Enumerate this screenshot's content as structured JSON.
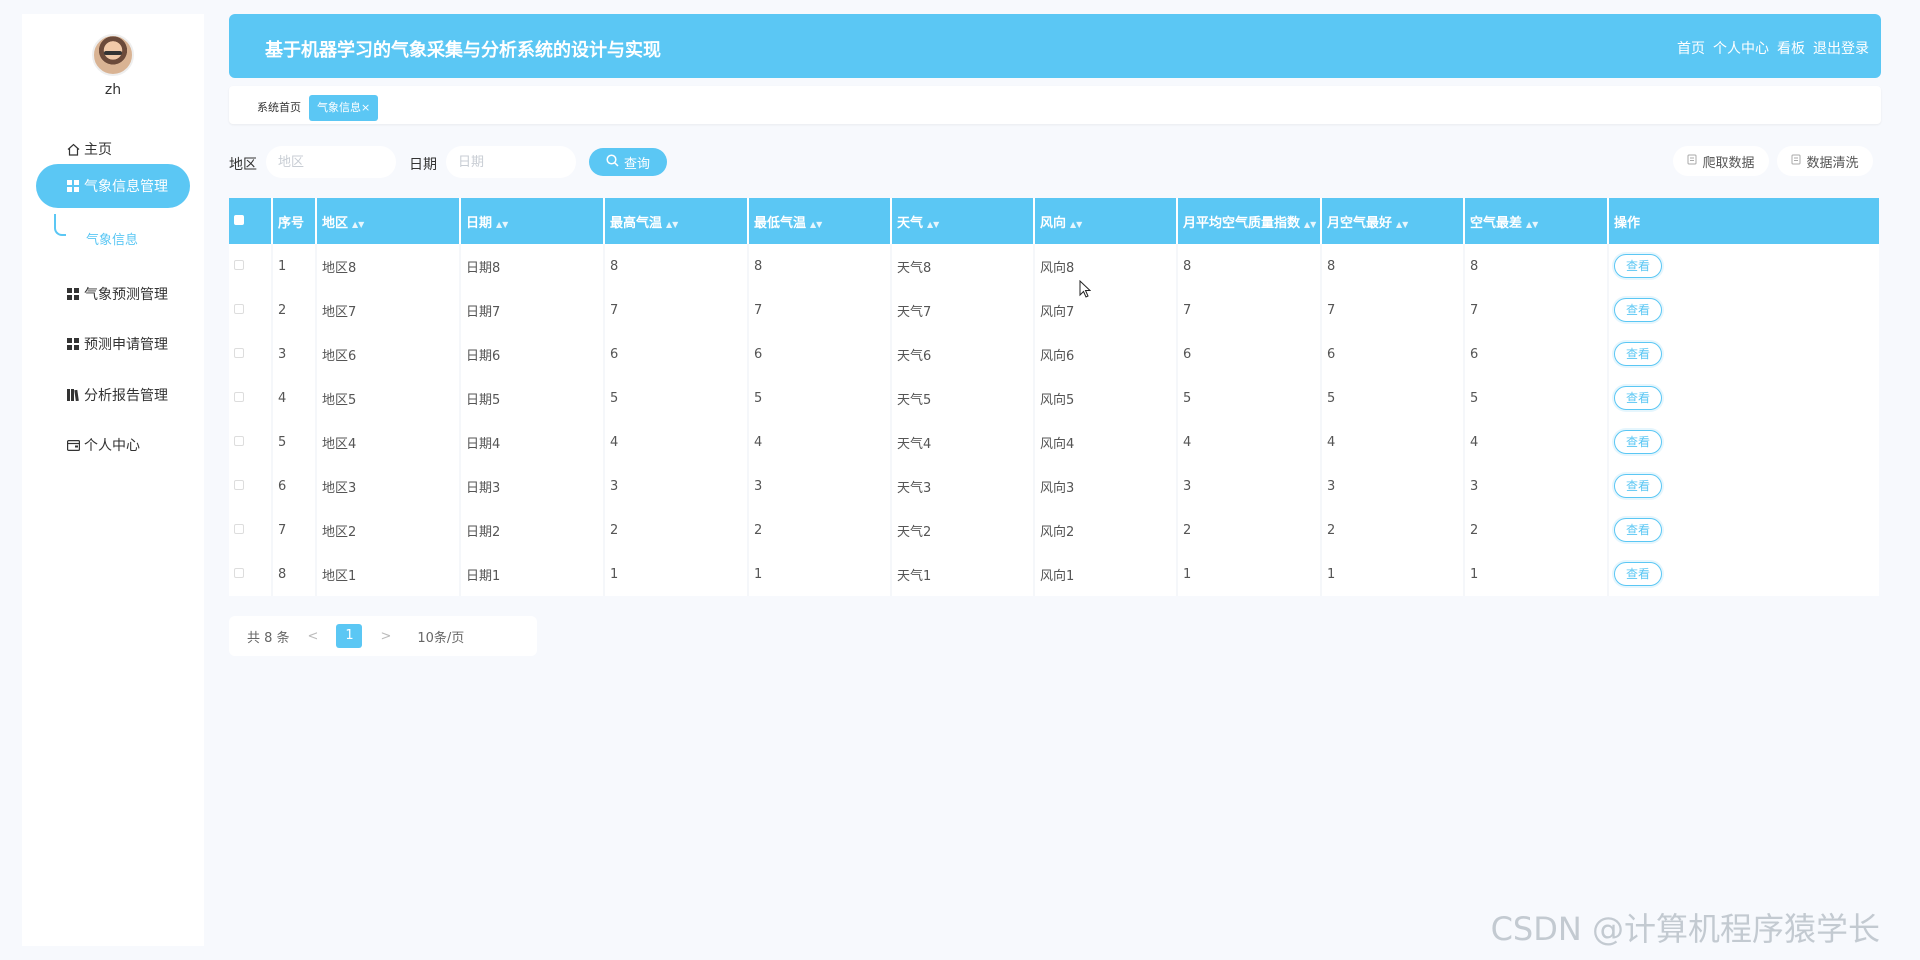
{
  "user": {
    "name": "zh"
  },
  "sidebar": {
    "items": [
      {
        "label": "主页",
        "icon": "home-icon"
      },
      {
        "label": "气象信息管理",
        "icon": "grid-icon",
        "active": true
      },
      {
        "label": "气象预测管理",
        "icon": "grid-icon"
      },
      {
        "label": "预测申请管理",
        "icon": "grid-icon"
      },
      {
        "label": "分析报告管理",
        "icon": "book-icon"
      },
      {
        "label": "个人中心",
        "icon": "wallet-icon"
      }
    ],
    "submenu": {
      "label": "气象信息"
    }
  },
  "header": {
    "title": "基于机器学习的气象采集与分析系统的设计与实现",
    "nav": [
      "首页",
      "个人中心",
      "看板",
      "退出登录"
    ]
  },
  "tabs": [
    {
      "label": "系统首页"
    },
    {
      "label": "气象信息",
      "close": "×",
      "active": true
    }
  ],
  "search": {
    "region_label": "地区",
    "region_placeholder": "地区",
    "date_label": "日期",
    "date_placeholder": "日期",
    "query_label": "查询",
    "crawl_label": "爬取数据",
    "clean_label": "数据清洗"
  },
  "table": {
    "columns": [
      "序号",
      "地区",
      "日期",
      "最高气温",
      "最低气温",
      "天气",
      "风向",
      "月平均空气质量指数",
      "月空气最好",
      "空气最差",
      "操作"
    ],
    "sort_arrow": "▲▼",
    "action_label": "查看",
    "rows": [
      [
        "1",
        "地区8",
        "日期8",
        "8",
        "8",
        "天气8",
        "风向8",
        "8",
        "8",
        "8"
      ],
      [
        "2",
        "地区7",
        "日期7",
        "7",
        "7",
        "天气7",
        "风向7",
        "7",
        "7",
        "7"
      ],
      [
        "3",
        "地区6",
        "日期6",
        "6",
        "6",
        "天气6",
        "风向6",
        "6",
        "6",
        "6"
      ],
      [
        "4",
        "地区5",
        "日期5",
        "5",
        "5",
        "天气5",
        "风向5",
        "5",
        "5",
        "5"
      ],
      [
        "5",
        "地区4",
        "日期4",
        "4",
        "4",
        "天气4",
        "风向4",
        "4",
        "4",
        "4"
      ],
      [
        "6",
        "地区3",
        "日期3",
        "3",
        "3",
        "天气3",
        "风向3",
        "3",
        "3",
        "3"
      ],
      [
        "7",
        "地区2",
        "日期2",
        "2",
        "2",
        "天气2",
        "风向2",
        "2",
        "2",
        "2"
      ],
      [
        "8",
        "地区1",
        "日期1",
        "1",
        "1",
        "天气1",
        "风向1",
        "1",
        "1",
        "1"
      ]
    ]
  },
  "pagination": {
    "total": "共 8 条",
    "prev": "<",
    "current": "1",
    "next": ">",
    "page_size": "10条/页"
  },
  "watermark": "CSDN @计算机程序猿学长",
  "colors": {
    "accent": "#5bc7f4",
    "background": "#f7f9fd"
  }
}
